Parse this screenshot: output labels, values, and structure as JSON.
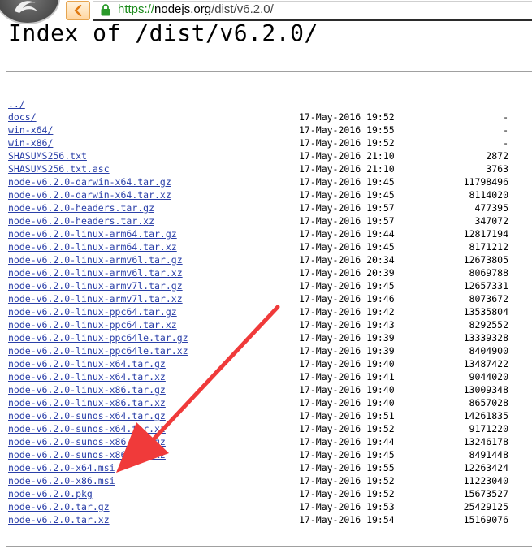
{
  "browser": {
    "url_scheme": "https://",
    "url_host": "nodejs.org",
    "url_path": "/dist/v6.2.0/"
  },
  "page": {
    "title": "Index of /dist/v6.2.0/"
  },
  "listing": [
    {
      "name": "../",
      "date": "",
      "size": ""
    },
    {
      "name": "docs/",
      "date": "17-May-2016 19:52",
      "size": "-"
    },
    {
      "name": "win-x64/",
      "date": "17-May-2016 19:55",
      "size": "-"
    },
    {
      "name": "win-x86/",
      "date": "17-May-2016 19:52",
      "size": "-"
    },
    {
      "name": "SHASUMS256.txt",
      "date": "17-May-2016 21:10",
      "size": "2872"
    },
    {
      "name": "SHASUMS256.txt.asc",
      "date": "17-May-2016 21:10",
      "size": "3763"
    },
    {
      "name": "node-v6.2.0-darwin-x64.tar.gz",
      "date": "17-May-2016 19:45",
      "size": "11798496"
    },
    {
      "name": "node-v6.2.0-darwin-x64.tar.xz",
      "date": "17-May-2016 19:45",
      "size": "8114020"
    },
    {
      "name": "node-v6.2.0-headers.tar.gz",
      "date": "17-May-2016 19:57",
      "size": "477395"
    },
    {
      "name": "node-v6.2.0-headers.tar.xz",
      "date": "17-May-2016 19:57",
      "size": "347072"
    },
    {
      "name": "node-v6.2.0-linux-arm64.tar.gz",
      "date": "17-May-2016 19:44",
      "size": "12817194"
    },
    {
      "name": "node-v6.2.0-linux-arm64.tar.xz",
      "date": "17-May-2016 19:45",
      "size": "8171212"
    },
    {
      "name": "node-v6.2.0-linux-armv6l.tar.gz",
      "date": "17-May-2016 20:34",
      "size": "12673805"
    },
    {
      "name": "node-v6.2.0-linux-armv6l.tar.xz",
      "date": "17-May-2016 20:39",
      "size": "8069788"
    },
    {
      "name": "node-v6.2.0-linux-armv7l.tar.gz",
      "date": "17-May-2016 19:45",
      "size": "12657331"
    },
    {
      "name": "node-v6.2.0-linux-armv7l.tar.xz",
      "date": "17-May-2016 19:46",
      "size": "8073672"
    },
    {
      "name": "node-v6.2.0-linux-ppc64.tar.gz",
      "date": "17-May-2016 19:42",
      "size": "13535804"
    },
    {
      "name": "node-v6.2.0-linux-ppc64.tar.xz",
      "date": "17-May-2016 19:43",
      "size": "8292552"
    },
    {
      "name": "node-v6.2.0-linux-ppc64le.tar.gz",
      "date": "17-May-2016 19:39",
      "size": "13339328"
    },
    {
      "name": "node-v6.2.0-linux-ppc64le.tar.xz",
      "date": "17-May-2016 19:39",
      "size": "8404900"
    },
    {
      "name": "node-v6.2.0-linux-x64.tar.gz",
      "date": "17-May-2016 19:40",
      "size": "13487422"
    },
    {
      "name": "node-v6.2.0-linux-x64.tar.xz",
      "date": "17-May-2016 19:41",
      "size": "9044020"
    },
    {
      "name": "node-v6.2.0-linux-x86.tar.gz",
      "date": "17-May-2016 19:40",
      "size": "13009348"
    },
    {
      "name": "node-v6.2.0-linux-x86.tar.xz",
      "date": "17-May-2016 19:40",
      "size": "8657028"
    },
    {
      "name": "node-v6.2.0-sunos-x64.tar.gz",
      "date": "17-May-2016 19:51",
      "size": "14261835"
    },
    {
      "name": "node-v6.2.0-sunos-x64.tar.xz",
      "date": "17-May-2016 19:52",
      "size": "9171220"
    },
    {
      "name": "node-v6.2.0-sunos-x86.tar.gz",
      "date": "17-May-2016 19:44",
      "size": "13246178"
    },
    {
      "name": "node-v6.2.0-sunos-x86.tar.xz",
      "date": "17-May-2016 19:45",
      "size": "8491448"
    },
    {
      "name": "node-v6.2.0-x64.msi",
      "date": "17-May-2016 19:55",
      "size": "12263424"
    },
    {
      "name": "node-v6.2.0-x86.msi",
      "date": "17-May-2016 19:52",
      "size": "11223040"
    },
    {
      "name": "node-v6.2.0.pkg",
      "date": "17-May-2016 19:52",
      "size": "15673527"
    },
    {
      "name": "node-v6.2.0.tar.gz",
      "date": "17-May-2016 19:53",
      "size": "25429125"
    },
    {
      "name": "node-v6.2.0.tar.xz",
      "date": "17-May-2016 19:54",
      "size": "15169076"
    }
  ],
  "colors": {
    "link": "#2a3fa8",
    "annotation_arrow": "#f03a3a",
    "https_green": "#1a8a1a"
  },
  "icons": {
    "browser_logo": "browser-logo-icon",
    "back": "back-arrow-icon",
    "lock": "lock-icon"
  }
}
